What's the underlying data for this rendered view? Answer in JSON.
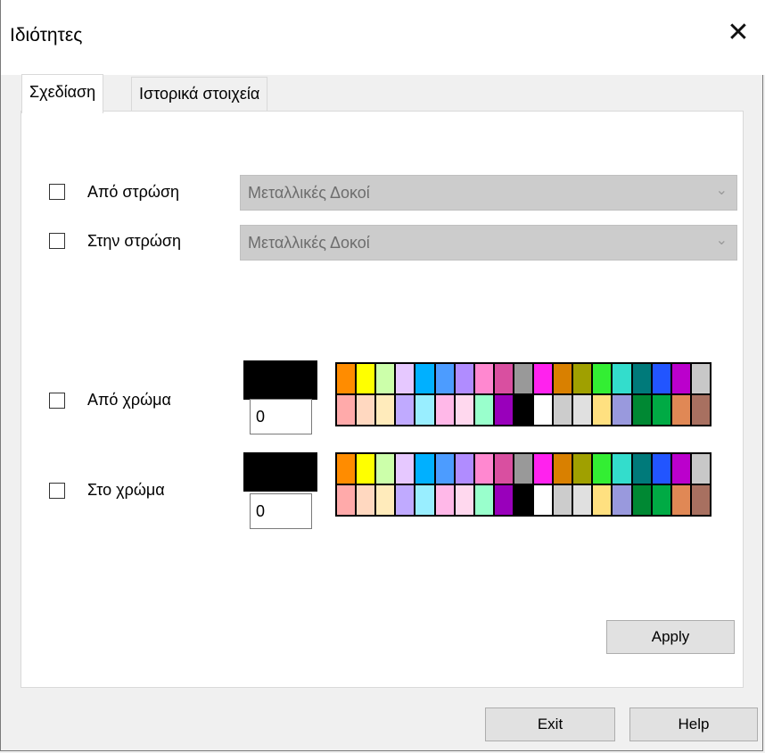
{
  "window": {
    "title": "Ιδιότητες",
    "close_glyph": "✕"
  },
  "tabs": [
    {
      "label": "Σχεδίαση"
    },
    {
      "label": "Ιστορικά στοιχεία"
    }
  ],
  "layers": {
    "from": {
      "label": "Από στρώση",
      "value": "Μεταλλικές Δοκοί",
      "checked": false
    },
    "to": {
      "label": "Στην στρώση",
      "value": "Μεταλλικές Δοκοί",
      "checked": false
    }
  },
  "colors": {
    "from": {
      "label": "Από χρώμα",
      "value": "0",
      "selected_color": "#000000",
      "checked": false
    },
    "to": {
      "label": "Στο χρώμα",
      "value": "0",
      "selected_color": "#000000",
      "checked": false
    }
  },
  "palette": {
    "row1": [
      "#ff8c00",
      "#ffff00",
      "#ccffaa",
      "#e6c8ff",
      "#00b0ff",
      "#4c9cff",
      "#b08cff",
      "#ff88d0",
      "#d94fa0",
      "#999999",
      "#ff22ee",
      "#d98000",
      "#a0a000",
      "#33ee33",
      "#33ddcc",
      "#007a7a",
      "#2255ff",
      "#bb00cc",
      "#c8c8c8"
    ],
    "row2": [
      "#ffaaaa",
      "#ffd8c0",
      "#ffebbb",
      "#c0aaff",
      "#99eeff",
      "#ffb8e8",
      "#ffd8ee",
      "#99ffcc",
      "#9900bb",
      "#000000",
      "#ffffff",
      "#cccccc",
      "#e0e0e0",
      "#ffe080",
      "#9999dd",
      "#008833",
      "#00aa44",
      "#e08855",
      "#a87060"
    ]
  },
  "buttons": {
    "apply": "Apply",
    "exit": "Exit",
    "help": "Help"
  }
}
